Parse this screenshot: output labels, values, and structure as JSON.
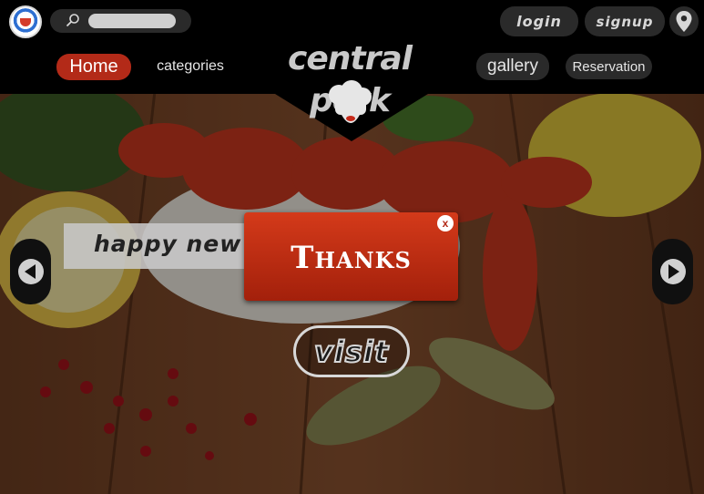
{
  "header": {
    "search": {
      "placeholder": "",
      "value": ""
    },
    "login_label": "login",
    "signup_label": "signup",
    "location_icon": "location-pin-icon"
  },
  "nav": {
    "items": [
      {
        "label": "Home",
        "active": true
      },
      {
        "label": "categories"
      },
      {
        "label": "gallery"
      },
      {
        "label": "Reservation"
      }
    ]
  },
  "brand": {
    "name": "central perk",
    "icon": "chef-hat-icon"
  },
  "slider": {
    "banner_text": "happy new",
    "prev_icon": "arrow-left-icon",
    "next_icon": "arrow-right-icon",
    "cta_label": "visit"
  },
  "dialog": {
    "message": "Thanks",
    "close_label": "x"
  },
  "colors": {
    "accent": "#b32a18",
    "dialog": "#c4300f",
    "bar": "#000000",
    "pill": "#2a2a2a"
  }
}
